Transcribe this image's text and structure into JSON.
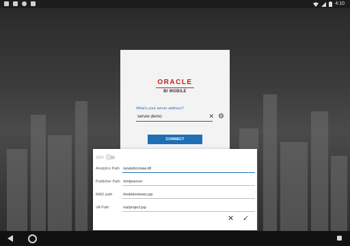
{
  "status_bar": {
    "time": "4:10"
  },
  "login": {
    "brand": "ORACLE",
    "subtitle": "BI MOBILE",
    "server_label": "What's your server address?",
    "server_value": "server.demo",
    "clear_icon": "close-icon",
    "settings_icon": "gear-icon",
    "connect_label": "CONNECT"
  },
  "dialog": {
    "sso_label": "SSO",
    "sso_enabled": false,
    "rows": [
      {
        "label": "Analytics Path",
        "value": "/analytics/saw.dll"
      },
      {
        "label": "Publisher Path",
        "value": "/xmlpserver"
      },
      {
        "label": "MAD path",
        "value": "/mobile/viewer.jsp"
      },
      {
        "label": "VA Path",
        "value": "/va/project.jsp"
      }
    ],
    "cancel_icon": "close-icon",
    "confirm_icon": "check-icon"
  },
  "nav_bar": {
    "icons": [
      "back-icon",
      "home-icon",
      "recents-icon"
    ]
  },
  "colors": {
    "accent": "#1f6fb5",
    "brand_red": "#c41e1e"
  }
}
